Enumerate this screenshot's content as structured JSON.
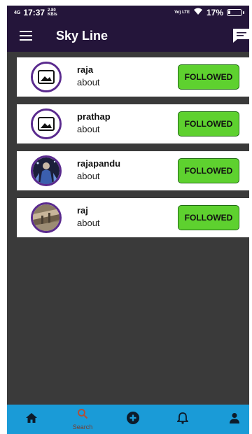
{
  "status_bar": {
    "network": "4G",
    "time": "17:37",
    "speed": "2.80",
    "speed_unit": "KB/s",
    "volte": "Vo) LTE",
    "battery": "17%",
    "battery_level": 0.17
  },
  "app_bar": {
    "title": "Sky Line",
    "menu_icon": "hamburger-menu-icon",
    "chat_icon": "chat-bubble-icon"
  },
  "users": [
    {
      "name": "raja",
      "about": "about",
      "button": "FOLLOWED",
      "avatar": "image-placeholder-icon"
    },
    {
      "name": "prathap",
      "about": "about",
      "button": "FOLLOWED",
      "avatar": "image-placeholder-icon"
    },
    {
      "name": "rajapandu",
      "about": "about",
      "button": "FOLLOWED",
      "avatar": "profile-photo"
    },
    {
      "name": "raj",
      "about": "about",
      "button": "FOLLOWED",
      "avatar": "profile-photo"
    }
  ],
  "bottom_nav": {
    "items": [
      {
        "icon": "home-icon",
        "label": ""
      },
      {
        "icon": "search-icon",
        "label": "Search",
        "active": true
      },
      {
        "icon": "add-circle-icon",
        "label": ""
      },
      {
        "icon": "bell-icon",
        "label": ""
      },
      {
        "icon": "person-icon",
        "label": ""
      }
    ]
  },
  "colors": {
    "app_bar": "#24153a",
    "background": "#3a3a3a",
    "follow_button": "#5ed12f",
    "bottom_nav": "#1a9bd7",
    "avatar_ring": "#5a2a8e"
  }
}
